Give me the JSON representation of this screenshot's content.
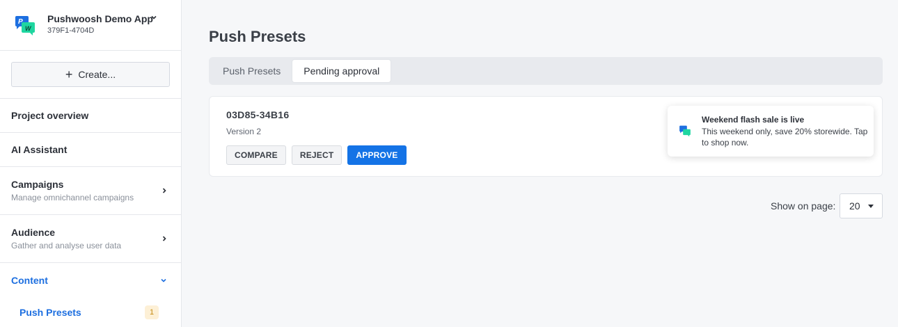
{
  "app": {
    "name": "Pushwoosh Demo App",
    "code": "379F1-4704D",
    "logo_icon": "pushwoosh-logo-icon",
    "brand_blue": "#1d6fe0",
    "brand_green": "#1fd6a0"
  },
  "sidebar": {
    "create_label": "Create...",
    "items": [
      {
        "label": "Project overview"
      },
      {
        "label": "AI Assistant"
      },
      {
        "label": "Campaigns",
        "sub": "Manage omnichannel campaigns"
      },
      {
        "label": "Audience",
        "sub": "Gather and analyse user data"
      },
      {
        "label": "Content",
        "expanded": true
      }
    ],
    "subitems": [
      {
        "label": "Push Presets",
        "badge": "1"
      }
    ]
  },
  "main": {
    "title": "Push Presets",
    "tabs": [
      {
        "label": "Push Presets",
        "active": false
      },
      {
        "label": "Pending approval",
        "active": true
      }
    ],
    "preset": {
      "code": "03D85-34B16",
      "version": "Version 2",
      "compare_label": "COMPARE",
      "reject_label": "REJECT",
      "approve_label": "APPROVE"
    },
    "toast": {
      "title": "Weekend flash sale is live",
      "body": "This weekend only, save 20% storewide. Tap to shop now."
    },
    "pager": {
      "label": "Show on page:",
      "value": "20"
    }
  },
  "colors": {
    "primary": "#1473e6",
    "badge_bg": "#fdf0d6",
    "badge_text": "#c58a12",
    "background": "#f6f7f9"
  }
}
